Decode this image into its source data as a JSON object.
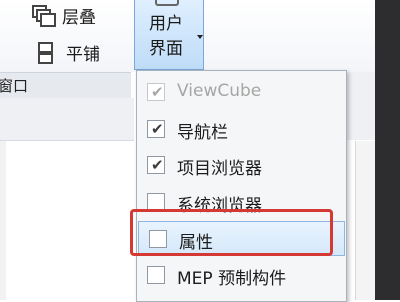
{
  "ribbon": {
    "cascade_label": "层叠",
    "tile_label": "平铺",
    "user_interface_label": "用户\n界面",
    "panel_label": "窗口"
  },
  "menu": {
    "items": [
      {
        "label": "ViewCube",
        "checked": true,
        "disabled": true
      },
      {
        "label": "导航栏",
        "checked": true,
        "disabled": false
      },
      {
        "label": "项目浏览器",
        "checked": true,
        "disabled": false
      },
      {
        "label": "系统浏览器",
        "checked": false,
        "disabled": false
      },
      {
        "label": "属性",
        "checked": false,
        "disabled": false,
        "hovered": true
      },
      {
        "label": "MEP 预制构件",
        "checked": false,
        "disabled": false
      }
    ]
  },
  "colors": {
    "highlight_box": "#d43a33",
    "ui_button_bg": "#bfdcf7",
    "menu_bg": "#f5f6f7",
    "dark_side": "#2d2d30"
  }
}
